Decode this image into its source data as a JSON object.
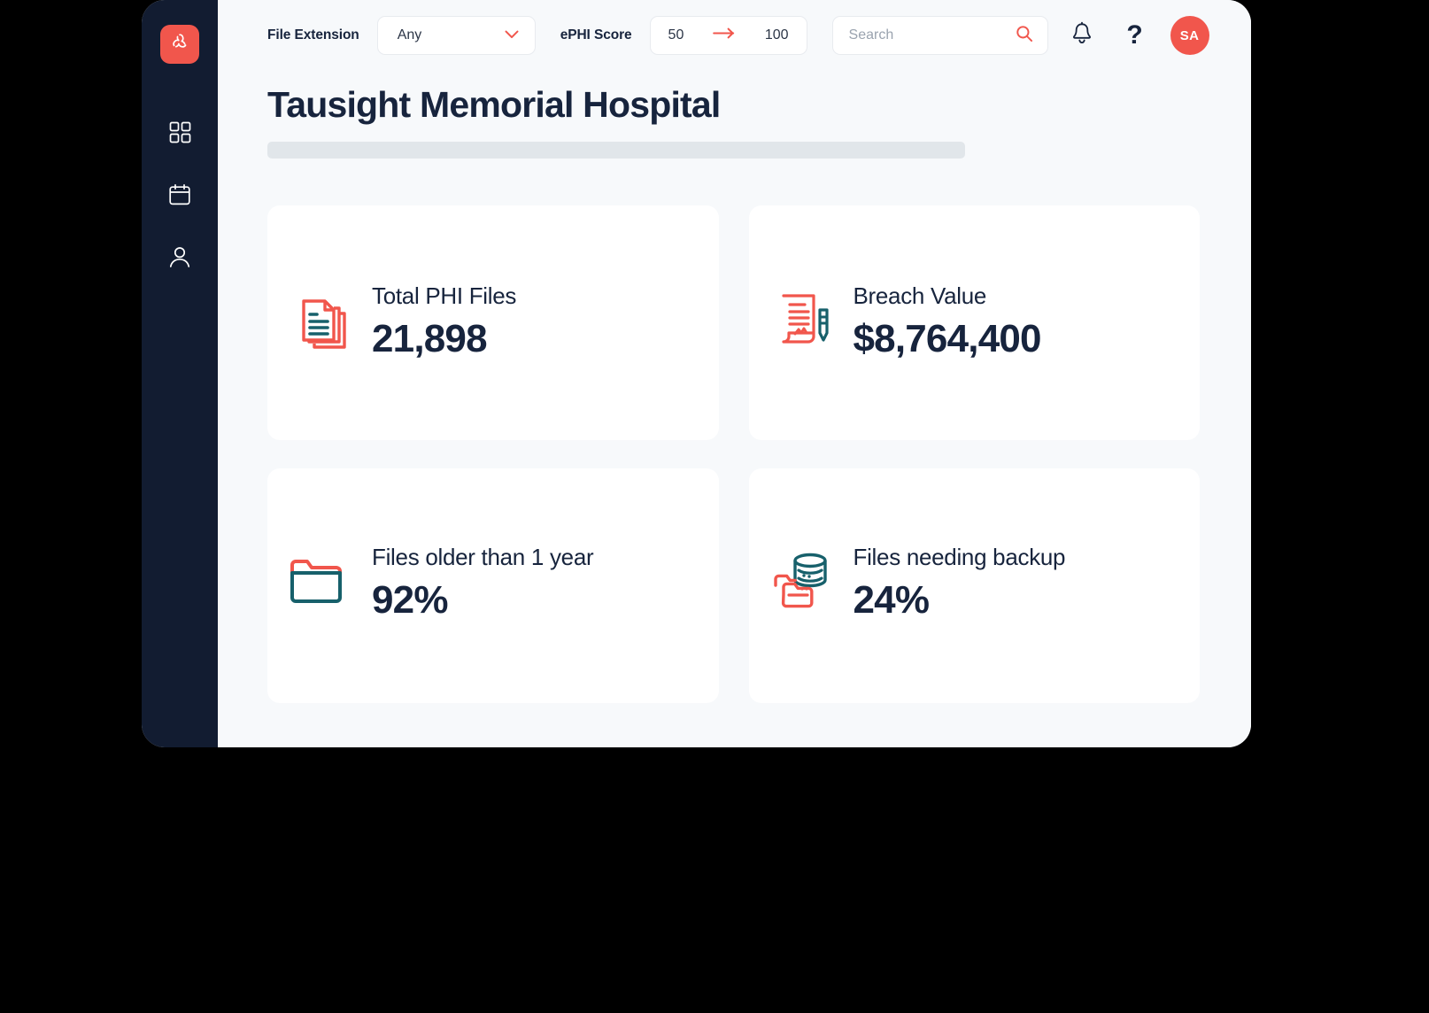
{
  "app": {
    "logo_icon": "tausight-trefoil-logo",
    "background_color": "#000000",
    "window_background": "#f7f9fb",
    "sidebar_color": "#121c31",
    "accent_color": "#f1564c",
    "ink_color": "#17243d",
    "teal_color": "#17606b"
  },
  "sidebar": {
    "items": [
      {
        "name": "dashboard",
        "icon": "grid-icon"
      },
      {
        "name": "calendar",
        "icon": "calendar-icon"
      },
      {
        "name": "profile",
        "icon": "person-icon"
      }
    ]
  },
  "toolbar": {
    "file_extension_label": "File Extension",
    "file_extension_value": "Any",
    "file_extension_options": [
      "Any"
    ],
    "ephi_score_label": "ePHI Score",
    "ephi_min": "50",
    "ephi_max": "100",
    "range_arrow_icon": "arrow-right-icon",
    "chevron_icon": "chevron-down-icon",
    "search_value": "",
    "search_placeholder": "Search",
    "search_icon": "search-icon",
    "notifications_icon": "bell-icon",
    "help_label": "?",
    "avatar_initials": "SA"
  },
  "page": {
    "title": "Tausight Memorial Hospital"
  },
  "cards": [
    {
      "label": "Total PHI Files",
      "value": "21,898",
      "icon": "documents-stack-icon"
    },
    {
      "label": "Breach Value",
      "value": "$8,764,400",
      "icon": "contract-pen-icon"
    },
    {
      "label": "Files older than 1 year",
      "value": "92%",
      "icon": "folder-icon"
    },
    {
      "label": "Files needing backup",
      "value": "24%",
      "icon": "database-folder-icon"
    }
  ]
}
